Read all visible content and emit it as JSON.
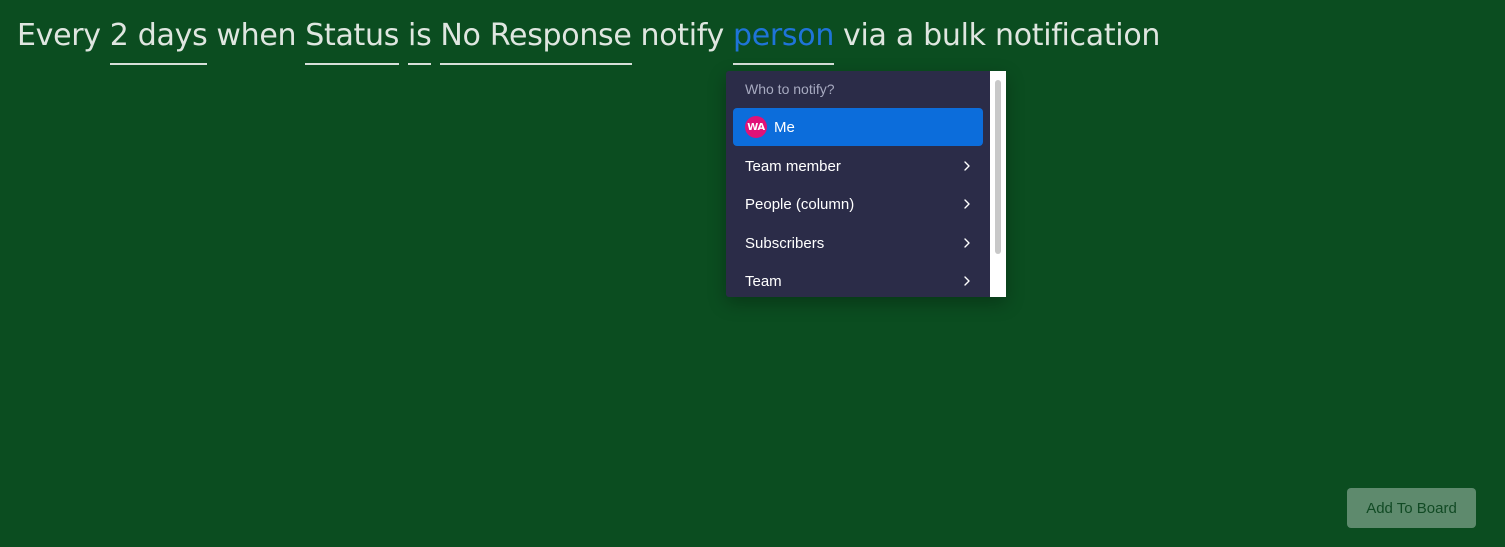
{
  "sentence": {
    "every": "Every",
    "interval": "2 days",
    "when": "when",
    "column": "Status",
    "is": "is",
    "status_value": "No Response",
    "notify": "notify",
    "recipient": "person",
    "tail": "via a bulk notification"
  },
  "dropdown": {
    "header": "Who to notify?",
    "items": [
      {
        "label": "Me",
        "avatar": "WA",
        "selected": true,
        "has_submenu": false
      },
      {
        "label": "Team member",
        "has_submenu": true
      },
      {
        "label": "People (column)",
        "has_submenu": true
      },
      {
        "label": "Subscribers",
        "has_submenu": true
      },
      {
        "label": "Team",
        "has_submenu": true
      }
    ]
  },
  "button": {
    "add_to_board": "Add To Board"
  },
  "colors": {
    "background": "#0b4d20",
    "menu_bg": "#2b2c48",
    "selected": "#0c6ddb",
    "link": "#1f74d8",
    "avatar": "#e01277"
  }
}
